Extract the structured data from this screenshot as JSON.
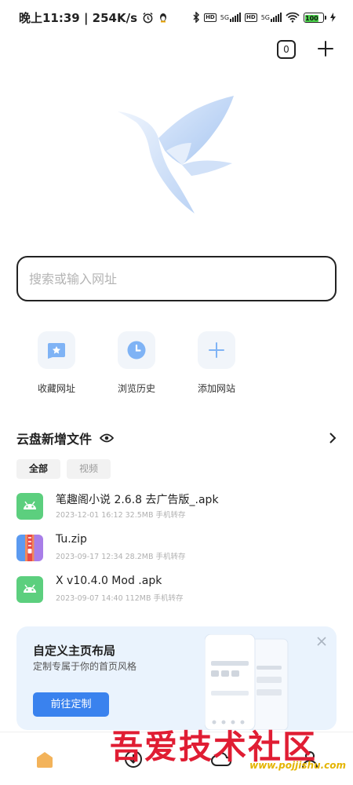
{
  "status_bar": {
    "time_speed": "晚上11:39 | 254K/s",
    "network_1": "5G",
    "network_2": "5G",
    "hd_1": "HD",
    "hd_2": "HD",
    "battery": "100"
  },
  "header": {
    "tab_count": "0"
  },
  "search": {
    "placeholder": "搜索或输入网址"
  },
  "quick_links": [
    {
      "label": "收藏网址",
      "icon": "bookmark-star-icon"
    },
    {
      "label": "浏览历史",
      "icon": "history-clock-icon"
    },
    {
      "label": "添加网站",
      "icon": "add-plus-icon"
    }
  ],
  "cloud": {
    "title": "云盘新增文件",
    "filters": [
      "全部",
      "视频"
    ],
    "active_filter": "全部",
    "files": [
      {
        "name": "笔趣阁小说 2.6.8 去广告版_.apk",
        "meta": "2023-12-01 16:12  32.5MB  手机转存",
        "icon": "android-apk-icon"
      },
      {
        "name": "Tu.zip",
        "meta": "2023-09-17 12:34  28.2MB  手机转存",
        "icon": "zip-archive-icon"
      },
      {
        "name": "X v10.4.0  Mod .apk",
        "meta": "2023-09-07 14:40  112MB  手机转存",
        "icon": "android-apk-icon"
      }
    ]
  },
  "promo": {
    "title": "自定义主页布局",
    "subtitle": "定制专属于你的首页风格",
    "button": "前往定制"
  },
  "watermark": {
    "text": "吾爱技术社区",
    "url": "www.pojjishu.com"
  },
  "colors": {
    "accent": "#3a82ee",
    "android": "#5ccf7e",
    "promo_bg": "#eaf3fd",
    "watermark_red": "#e01d33"
  }
}
